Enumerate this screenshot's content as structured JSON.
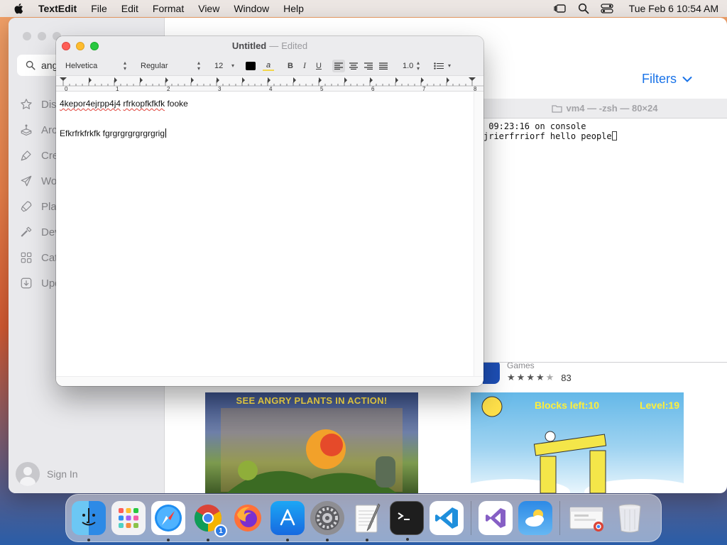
{
  "menubar": {
    "app_name": "TextEdit",
    "items": [
      "File",
      "Edit",
      "Format",
      "View",
      "Window",
      "Help"
    ],
    "clock": "Tue Feb 6  10:54 AM"
  },
  "appstore": {
    "search_value": "angr",
    "nav": [
      {
        "label": "Disc",
        "icon": "star-icon"
      },
      {
        "label": "Arca",
        "icon": "arcade-icon"
      },
      {
        "label": "Crea",
        "icon": "brush-icon"
      },
      {
        "label": "Wor",
        "icon": "paperplane-icon"
      },
      {
        "label": "Play",
        "icon": "rocket-icon"
      },
      {
        "label": "Dev",
        "icon": "hammer-icon"
      },
      {
        "label": "Cate",
        "icon": "grid-icon"
      },
      {
        "label": "Upd",
        "icon": "download-icon"
      }
    ],
    "sign_in": "Sign In",
    "filters": "Filters",
    "games_category": "Games",
    "rating_count": "83",
    "rating_stars": 4.5,
    "banner1_title": "SEE ANGRY PLANTS IN ACTION!",
    "banner2_blocks": "Blocks left:10",
    "banner2_level": "Level:19"
  },
  "terminal": {
    "title": "vm4 — -zsh — 80×24",
    "lines": [
      " 09:23:16 on console",
      "jrierfrriorf hello people"
    ]
  },
  "textedit": {
    "title": "Untitled",
    "title_sep": "—",
    "title_status": "Edited",
    "font": "Helvetica",
    "style": "Regular",
    "size": "12",
    "spacing": "1.0",
    "ruler_numbers": [
      "0",
      "1",
      "2",
      "3",
      "4",
      "5",
      "6",
      "7",
      "8"
    ],
    "doc": {
      "line1_a": "4kepor4ejrpp4j4",
      "line1_b": "rfrkopfkfkfk",
      "line1_c": "fooke",
      "line2": "Efkrfrkfrkfk fgrgrgrgrgrgrgrig"
    }
  },
  "dock": [
    {
      "name": "Finder",
      "icon": "finder-icon",
      "running": true
    },
    {
      "name": "Launchpad",
      "icon": "launchpad-icon",
      "running": false
    },
    {
      "name": "Safari",
      "icon": "safari-icon",
      "running": true
    },
    {
      "name": "Chrome",
      "icon": "chrome-icon",
      "running": true,
      "badge": "1"
    },
    {
      "name": "Firefox",
      "icon": "firefox-icon",
      "running": false
    },
    {
      "name": "App Store",
      "icon": "appstore-icon",
      "running": true
    },
    {
      "name": "System Settings",
      "icon": "settings-icon",
      "running": true
    },
    {
      "name": "TextEdit",
      "icon": "textedit-icon",
      "running": true
    },
    {
      "name": "Terminal",
      "icon": "terminal-icon",
      "running": true
    },
    {
      "name": "VS Code",
      "icon": "vscode-icon",
      "running": false
    },
    {
      "name": "Visual Studio",
      "icon": "visualstudio-icon",
      "running": false
    },
    {
      "name": "Weather",
      "icon": "weather-icon",
      "running": false
    },
    {
      "name": "Chrome window",
      "icon": "chrome-window-icon",
      "running": false
    },
    {
      "name": "Trash",
      "icon": "trash-icon",
      "running": false
    }
  ]
}
